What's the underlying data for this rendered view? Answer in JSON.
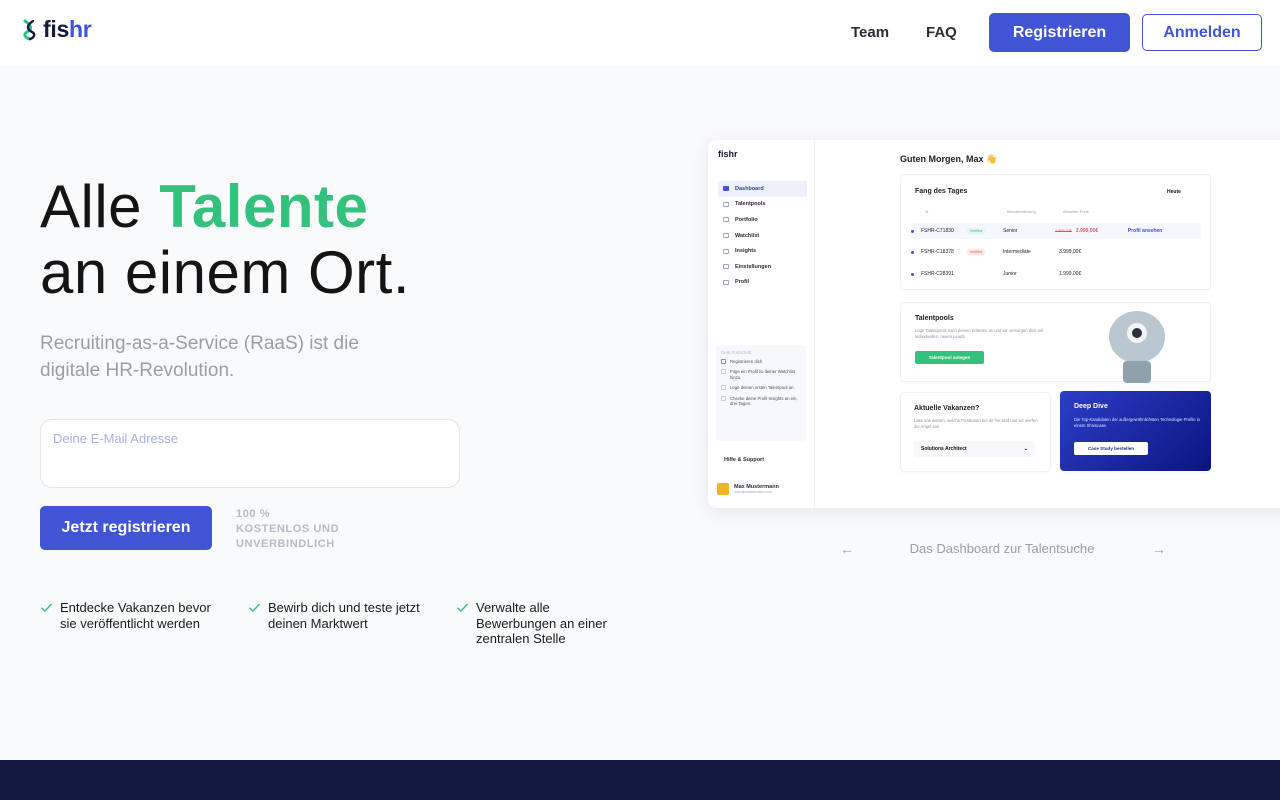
{
  "brand": {
    "logo_part1": "fis",
    "logo_part2": "hr",
    "accent": "#4154d6",
    "green": "#33c17d",
    "footer_color": "#121840"
  },
  "nav": {
    "team": "Team",
    "faq": "FAQ",
    "register": "Registrieren",
    "login": "Anmelden"
  },
  "hero": {
    "title_prefix": "Alle",
    "title_highlight": "Talente",
    "title_line2": "an einem Ort.",
    "subtitle": "Recruiting-as-a-Service (RaaS) ist die digitale HR-Revolution.",
    "email_label": "Deine E-Mail Adresse",
    "email_value": "",
    "cta": "Jetzt registrieren",
    "free_note": "100 % KOSTENLOS UND UNVERBINDLICH"
  },
  "features": [
    {
      "icon": "check-icon",
      "text": "Entdecke Vakanzen bevor sie veröffentlicht werden"
    },
    {
      "icon": "check-icon",
      "text": "Bewirb dich und teste jetzt deinen Marktwert"
    },
    {
      "icon": "check-icon",
      "text": "Verwalte alle Bewerbungen an einer zentralen Stelle"
    }
  ],
  "preview": {
    "logo": "fishr",
    "greeting": "Guten Morgen, Max 👋",
    "menu": [
      "Dashboard",
      "Talentpools",
      "Portfolio",
      "Watchlist",
      "Insights",
      "Einstellungen",
      "Profil"
    ],
    "side_card_title": "Dein Fortschritt",
    "side_card_items": [
      "Registrieren dich",
      "Füge ein Profil zu deiner Watchlist hinzu.",
      "Lege deinen ersten Talentpool an.",
      "Checke deine Profil-Insights an ein, drei Tagen."
    ],
    "help": "Hilfe & Support",
    "user_name": "Max Mustermann",
    "user_mail": "max@mustermann.com",
    "fang": {
      "title": "Fang des Tages",
      "period": "Heute",
      "headers": [
        "Id",
        "Berufserfahrung",
        "Aktueller Preis"
      ],
      "rows": [
        {
          "id": "FSHR-C71830",
          "tag": "Verified",
          "level": "Senior",
          "old_price": "2.999,00€",
          "price": "2.999,00€",
          "action": "Profil ansehen"
        },
        {
          "id": "FSHR-C18378",
          "tag": "Verified",
          "level": "Intermediate",
          "price": "3.999,00€"
        },
        {
          "id": "FSHR-C28391",
          "level": "Junior",
          "price": "1.999,00€"
        }
      ]
    },
    "talentpools": {
      "title": "Talentpools",
      "text": "Lege Talentpools nach deinen Kriterien an und wir versorgen dich mit individuellen, neuen Leads.",
      "button": "Talentpool anlegen"
    },
    "vakanzen": {
      "title": "Aktuelle Vakanzen?",
      "text": "Lass uns wissen, welche Positionen bei dir frei sind und wir werfen die Angel aus.",
      "select": "Solutions Architect"
    },
    "deepdive": {
      "title": "Deep Dive",
      "text": "Die Top-Kandidaten der außergewöhnlichsten Technologie-Profile in einem Showcase.",
      "button": "Case Study bestellen"
    }
  },
  "carousel": {
    "caption": "Das Dashboard zur Talentsuche"
  }
}
